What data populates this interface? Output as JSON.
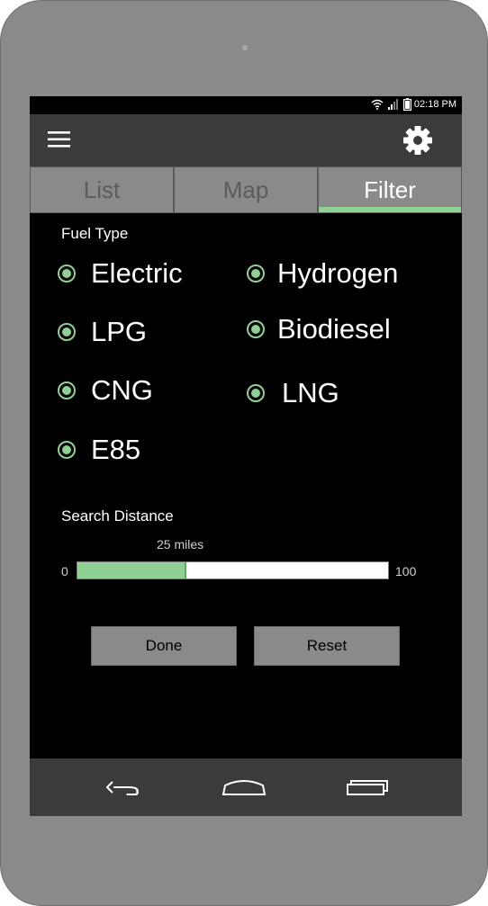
{
  "status": {
    "time": "02:18 PM"
  },
  "tabs": [
    {
      "label": "List",
      "active": false
    },
    {
      "label": "Map",
      "active": false
    },
    {
      "label": "Filter",
      "active": true
    }
  ],
  "filter": {
    "fuel_type_label": "Fuel Type",
    "fuel_types": [
      {
        "label": "Electric",
        "selected": true
      },
      {
        "label": "Hydrogen",
        "selected": true
      },
      {
        "label": "LPG",
        "selected": true
      },
      {
        "label": "Biodiesel",
        "selected": true
      },
      {
        "label": "CNG",
        "selected": true
      },
      {
        "label": "LNG",
        "selected": true
      },
      {
        "label": "E85",
        "selected": true
      }
    ],
    "distance_label": "Search Distance",
    "distance_value": "25 miles",
    "distance_min": "0",
    "distance_max": "100",
    "distance_fraction": 0.25,
    "done_label": "Done",
    "reset_label": "Reset"
  },
  "icons": [
    "menu-icon",
    "gear-icon",
    "wifi-icon",
    "signal-icon",
    "battery-icon",
    "back-icon",
    "home-icon",
    "recents-icon"
  ],
  "colors": {
    "accent": "#8fd192",
    "appbar": "#3b3b3b",
    "tab_bg": "#8a8a8a",
    "content_bg": "#000000"
  }
}
